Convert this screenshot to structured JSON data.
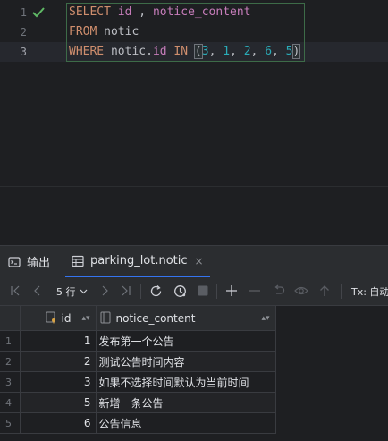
{
  "editor": {
    "lines": [
      {
        "number": "1",
        "tokens": [
          {
            "cls": "kw",
            "text": "SELECT"
          },
          {
            "cls": "plain",
            "text": " "
          },
          {
            "cls": "col",
            "text": "id"
          },
          {
            "cls": "plain",
            "text": " , "
          },
          {
            "cls": "col",
            "text": "notice_content"
          }
        ]
      },
      {
        "number": "2",
        "tokens": [
          {
            "cls": "kw",
            "text": "FROM"
          },
          {
            "cls": "plain",
            "text": " notic"
          }
        ]
      },
      {
        "number": "3",
        "tokens": [
          {
            "cls": "kw",
            "text": "WHERE"
          },
          {
            "cls": "plain",
            "text": " notic."
          },
          {
            "cls": "col",
            "text": "id"
          },
          {
            "cls": "plain",
            "text": " "
          },
          {
            "cls": "kw",
            "text": "IN"
          },
          {
            "cls": "plain",
            "text": " "
          },
          {
            "cls": "paren",
            "text": "("
          },
          {
            "cls": "num",
            "text": "3"
          },
          {
            "cls": "plain",
            "text": ", "
          },
          {
            "cls": "num",
            "text": "1"
          },
          {
            "cls": "plain",
            "text": ", "
          },
          {
            "cls": "num",
            "text": "2"
          },
          {
            "cls": "plain",
            "text": ", "
          },
          {
            "cls": "num",
            "text": "6"
          },
          {
            "cls": "plain",
            "text": ", "
          },
          {
            "cls": "num",
            "text": "5"
          },
          {
            "cls": "paren",
            "text": ")"
          }
        ]
      }
    ],
    "status_icon": "check-icon"
  },
  "tabs": {
    "output_label": "输出",
    "result_label": "parking_lot.notic",
    "close_glyph": "×"
  },
  "toolbar": {
    "row_count_label": "5 行",
    "tx_label": "Tx: 自动"
  },
  "grid": {
    "columns": [
      "id",
      "notice_content"
    ],
    "rows": [
      {
        "row": "1",
        "id": "1",
        "notice_content": "发布第一个公告"
      },
      {
        "row": "2",
        "id": "2",
        "notice_content": "测试公告时间内容"
      },
      {
        "row": "3",
        "id": "3",
        "notice_content": "如果不选择时间默认为当前时间"
      },
      {
        "row": "4",
        "id": "5",
        "notice_content": "新增一条公告"
      },
      {
        "row": "5",
        "id": "6",
        "notice_content": "公告信息"
      }
    ]
  },
  "colors": {
    "accent": "#3574f0",
    "keyword": "#cf8e6d",
    "column": "#c77dbb",
    "number": "#2aacb8",
    "success": "#5fb865"
  }
}
